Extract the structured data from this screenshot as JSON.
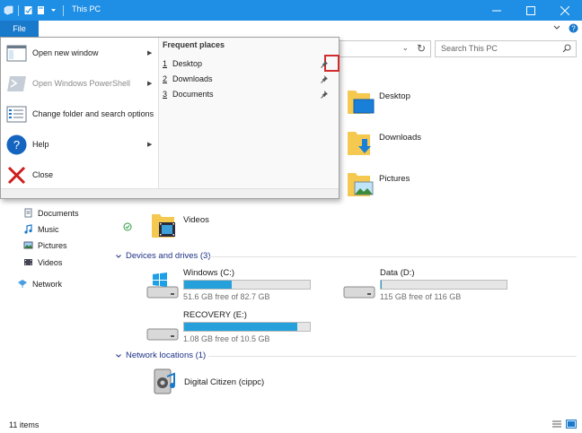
{
  "window": {
    "title": "This PC",
    "controls": [
      "minimize",
      "maximize",
      "close"
    ]
  },
  "ribbon": {
    "file_tab": "File"
  },
  "search": {
    "placeholder": "Search This PC"
  },
  "file_menu": {
    "items": [
      {
        "label": "Open new window",
        "icon": "new-window-icon",
        "has_submenu": true,
        "enabled": true
      },
      {
        "label": "Open Windows PowerShell",
        "icon": "powershell-icon",
        "has_submenu": true,
        "enabled": false
      },
      {
        "label": "Change folder and search options",
        "icon": "folder-options-icon",
        "has_submenu": false,
        "enabled": true
      },
      {
        "label": "Help",
        "icon": "help-icon",
        "has_submenu": true,
        "enabled": true
      },
      {
        "label": "Close",
        "icon": "close-icon",
        "has_submenu": false,
        "enabled": true
      }
    ],
    "frequent_places": {
      "title": "Frequent places",
      "items": [
        {
          "num": "1",
          "label": "Desktop"
        },
        {
          "num": "2",
          "label": "Downloads"
        },
        {
          "num": "3",
          "label": "Documents"
        }
      ]
    }
  },
  "sidebar": {
    "items": [
      {
        "label": "Documents",
        "icon": "documents-icon"
      },
      {
        "label": "Music",
        "icon": "music-icon"
      },
      {
        "label": "Pictures",
        "icon": "pictures-icon"
      },
      {
        "label": "Videos",
        "icon": "videos-icon"
      },
      {
        "label": "Network",
        "icon": "network-icon"
      }
    ]
  },
  "folders": [
    {
      "label": "Desktop"
    },
    {
      "label": "Downloads"
    },
    {
      "label": "Pictures"
    },
    {
      "label": "Videos"
    }
  ],
  "sections": {
    "devices": "Devices and drives (3)",
    "network": "Network locations (1)"
  },
  "drives": [
    {
      "name": "Windows (C:)",
      "free": "51.6 GB free of 82.7 GB",
      "used_fraction": 0.376
    },
    {
      "name": "Data (D:)",
      "free": "115 GB free of 116 GB",
      "used_fraction": 0.01
    },
    {
      "name": "RECOVERY (E:)",
      "free": "1.08 GB free of 10.5 GB",
      "used_fraction": 0.897
    }
  ],
  "network_locations": [
    {
      "label": "Digital Citizen (cippc)"
    }
  ],
  "status": {
    "count": "11 items"
  },
  "colors": {
    "titlebar": "#1f8fe6",
    "file_tab": "#1979ca",
    "drive_fill": "#26a0da",
    "section_header": "#1e3287",
    "pin_highlight": "#d12b2b"
  }
}
